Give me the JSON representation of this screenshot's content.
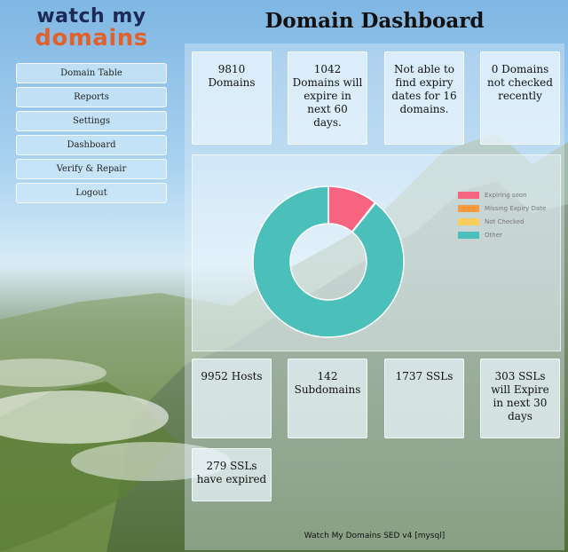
{
  "logo": {
    "line1": "watch my",
    "line2": "domains"
  },
  "page_title": "Domain Dashboard",
  "nav": [
    {
      "label": "Domain Table"
    },
    {
      "label": "Reports"
    },
    {
      "label": "Settings"
    },
    {
      "label": "Dashboard"
    },
    {
      "label": "Verify & Repair"
    },
    {
      "label": "Logout"
    }
  ],
  "top_cards": [
    {
      "text": "9810 Domains"
    },
    {
      "text": "1042 Domains will expire in next 60 days."
    },
    {
      "text": "Not able to find expiry dates for 16 domains."
    },
    {
      "text": "0 Domains not checked recently"
    }
  ],
  "bottom_cards": [
    {
      "text": "9952 Hosts"
    },
    {
      "text": "142 Subdomains"
    },
    {
      "text": "1737 SSLs"
    },
    {
      "text": "303 SSLs will Expire in next 30 days"
    },
    {
      "text": "279 SSLs have expired"
    }
  ],
  "chart_data": {
    "type": "pie",
    "labels": [
      "Expiring soon",
      "Missing Expiry Date",
      "Not Checked",
      "Other"
    ],
    "values": [
      1042,
      16,
      0,
      8752
    ],
    "colors": [
      "#f7647f",
      "#f59a3d",
      "#f7cf5c",
      "#4bbfb9"
    ],
    "legend_position": "right"
  },
  "footer": "Watch My Domains SED v4 [mysql]"
}
